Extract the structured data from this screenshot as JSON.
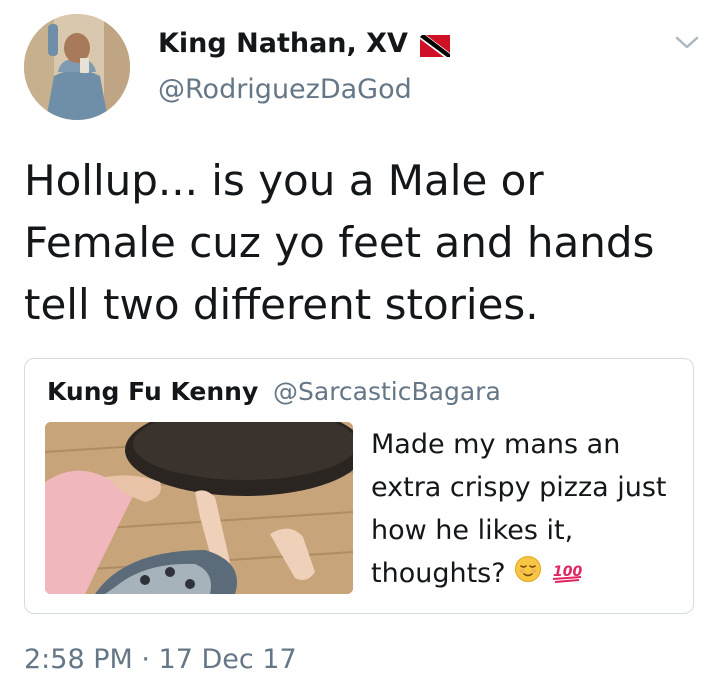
{
  "author": {
    "display_name": "King Nathan, XV",
    "handle": "@RodriguezDaGod",
    "flag": "trinidad-and-tobago-flag"
  },
  "tweet": {
    "text": "Hollup... is you a Male or Female cuz yo feet and hands tell two different stories."
  },
  "quoted_tweet": {
    "display_name": "Kung Fu Kenny",
    "handle": "@SarcasticBagara",
    "text": "Made my mans an extra crispy pizza just how he likes it, thoughts?",
    "emojis": [
      "relieved-face-emoji",
      "hundred-points-emoji"
    ]
  },
  "timestamp": "2:58 PM · 17 Dec 17",
  "colors": {
    "text": "#14171a",
    "secondary": "#657786",
    "border": "#d5dbe0"
  }
}
